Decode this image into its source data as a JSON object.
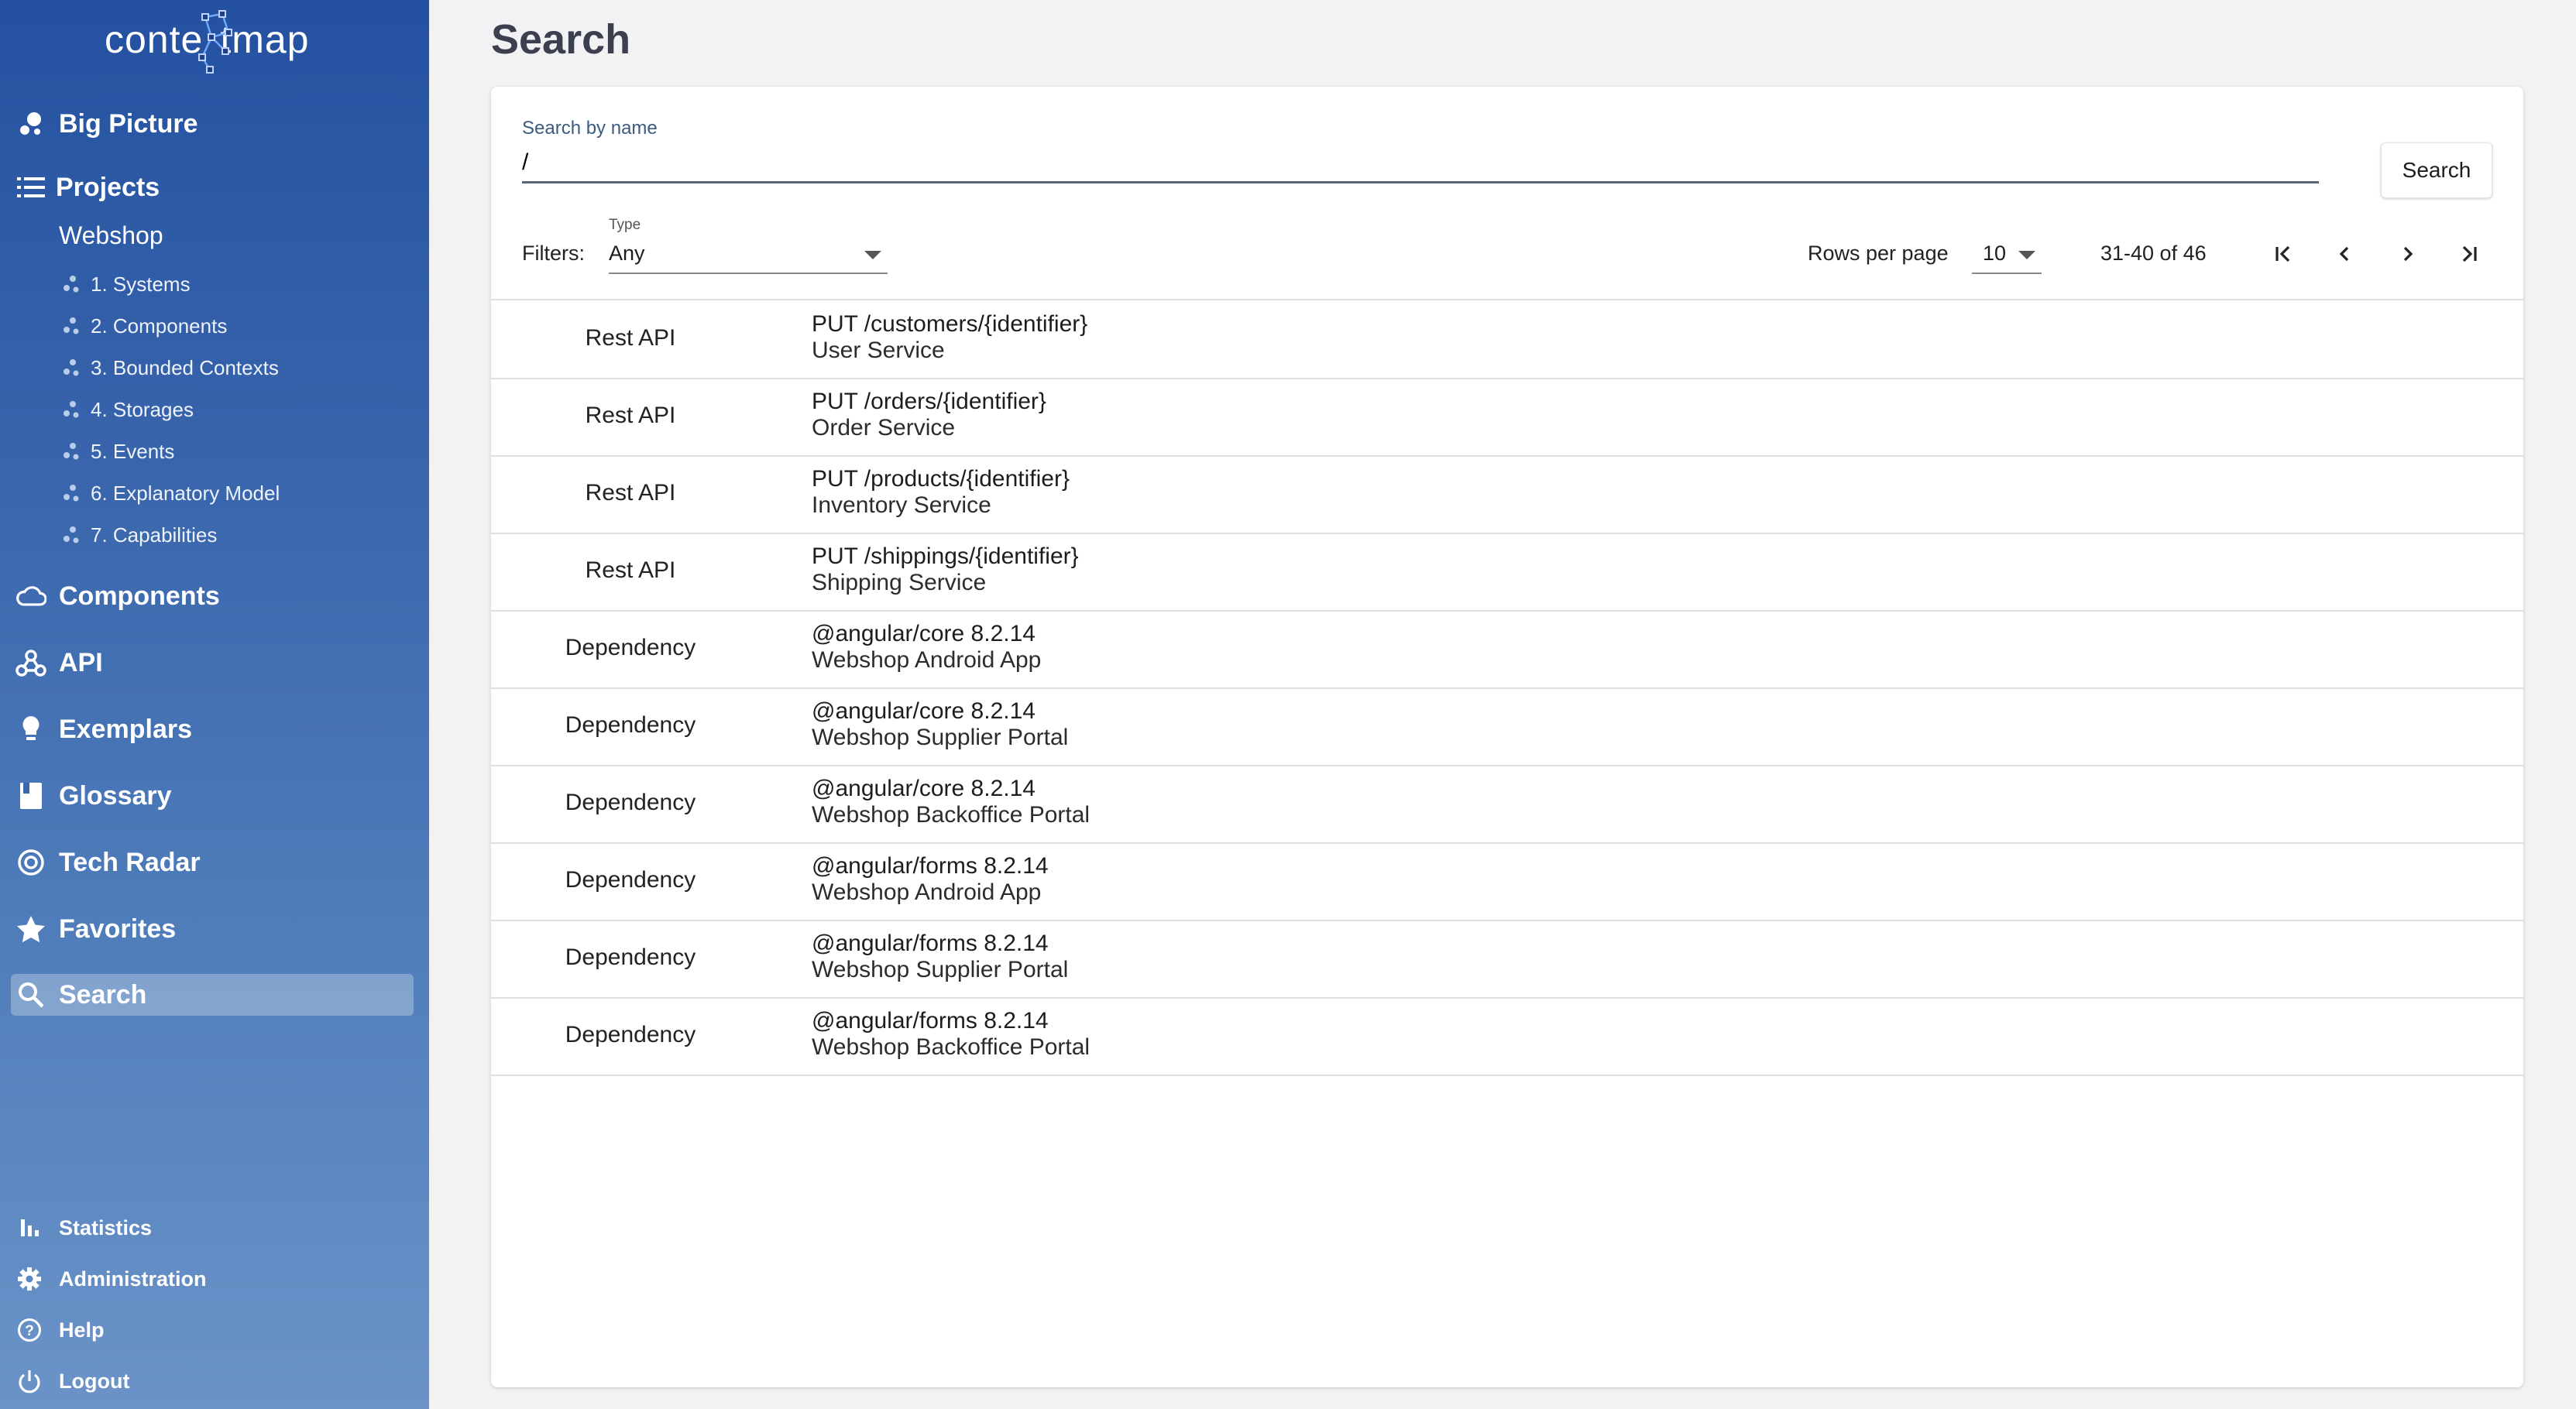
{
  "app": {
    "logo_left": "conte",
    "logo_right": "tmap"
  },
  "sidebar": {
    "nav": [
      {
        "label": "Big Picture",
        "icon": "bubbles-icon"
      },
      {
        "label": "Projects",
        "icon": "list-icon"
      },
      {
        "label": "Components",
        "icon": "cloud-icon"
      },
      {
        "label": "API",
        "icon": "webhook-icon"
      },
      {
        "label": "Exemplars",
        "icon": "lightbulb-icon"
      },
      {
        "label": "Glossary",
        "icon": "book-icon"
      },
      {
        "label": "Tech Radar",
        "icon": "radar-icon"
      },
      {
        "label": "Favorites",
        "icon": "star-icon"
      },
      {
        "label": "Search",
        "icon": "search-icon"
      }
    ],
    "project_name": "Webshop",
    "project_items": [
      {
        "label": "1. Systems"
      },
      {
        "label": "2. Components"
      },
      {
        "label": "3. Bounded Contexts"
      },
      {
        "label": "4. Storages"
      },
      {
        "label": "5. Events"
      },
      {
        "label": "6. Explanatory Model"
      },
      {
        "label": "7. Capabilities"
      }
    ],
    "bottom": [
      {
        "label": "Statistics",
        "icon": "bar-chart-icon"
      },
      {
        "label": "Administration",
        "icon": "gear-icon"
      },
      {
        "label": "Help",
        "icon": "help-icon"
      },
      {
        "label": "Logout",
        "icon": "power-icon"
      }
    ],
    "active": "Search"
  },
  "main": {
    "title": "Search",
    "search": {
      "label": "Search by name",
      "value": "/",
      "button": "Search"
    },
    "filters": {
      "label": "Filters:",
      "type_label": "Type",
      "type_value": "Any"
    },
    "pagination": {
      "rows_label": "Rows per page",
      "rows_value": "10",
      "range": "31-40 of 46"
    },
    "results": [
      {
        "type": "Rest API",
        "name": "PUT /customers/{identifier}",
        "sub": "User Service"
      },
      {
        "type": "Rest API",
        "name": "PUT /orders/{identifier}",
        "sub": "Order Service"
      },
      {
        "type": "Rest API",
        "name": "PUT /products/{identifier}",
        "sub": "Inventory Service"
      },
      {
        "type": "Rest API",
        "name": "PUT /shippings/{identifier}",
        "sub": "Shipping Service"
      },
      {
        "type": "Dependency",
        "name": "@angular/core 8.2.14",
        "sub": "Webshop Android App"
      },
      {
        "type": "Dependency",
        "name": "@angular/core 8.2.14",
        "sub": "Webshop Supplier Portal"
      },
      {
        "type": "Dependency",
        "name": "@angular/core 8.2.14",
        "sub": "Webshop Backoffice Portal"
      },
      {
        "type": "Dependency",
        "name": "@angular/forms 8.2.14",
        "sub": "Webshop Android App"
      },
      {
        "type": "Dependency",
        "name": "@angular/forms 8.2.14",
        "sub": "Webshop Supplier Portal"
      },
      {
        "type": "Dependency",
        "name": "@angular/forms 8.2.14",
        "sub": "Webshop Backoffice Portal"
      }
    ]
  },
  "colors": {
    "sidebar_top": "#2451a0",
    "sidebar_bottom": "#6b93c8",
    "background": "#f2f2f4",
    "card": "#ffffff"
  }
}
